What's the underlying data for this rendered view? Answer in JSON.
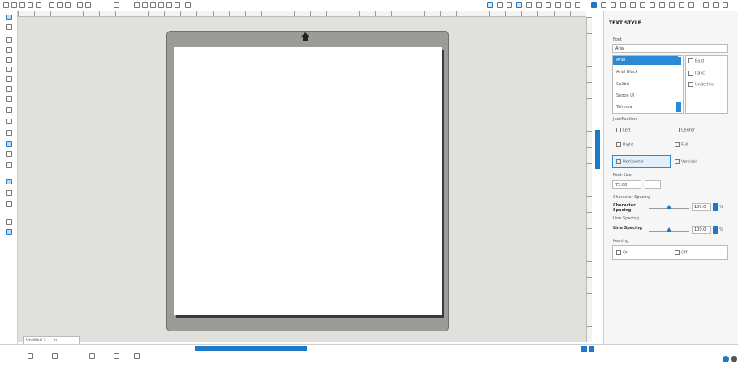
{
  "panel": {
    "title": "TEXT STYLE",
    "font_section_label": "Font",
    "font_search_value": "Arial",
    "font_list": [
      "Arial",
      "Arial Black",
      "Calibri",
      "Segoe UI",
      "Tahoma"
    ],
    "style_options": [
      {
        "label": "Bold",
        "icon": "bold-icon"
      },
      {
        "label": "Italic",
        "icon": "italic-icon"
      },
      {
        "label": "Underline",
        "icon": "underline-icon"
      }
    ],
    "justification_label": "Justification",
    "justification_options": [
      {
        "label": "Left",
        "icon": "align-left-icon"
      },
      {
        "label": "Center",
        "icon": "align-center-icon"
      },
      {
        "label": "Right",
        "icon": "align-right-icon"
      },
      {
        "label": "Full",
        "icon": "align-full-icon"
      }
    ],
    "direction_options": [
      {
        "label": "Horizontal",
        "icon": "text-horizontal-icon"
      },
      {
        "label": "Vertical",
        "icon": "text-vertical-icon"
      }
    ],
    "font_size_label": "Font Size",
    "font_size_value": "72.00",
    "char_spacing_section": "Character Spacing",
    "char_spacing_label": "Character Spacing",
    "char_spacing_value": "100.0",
    "line_spacing_section": "Line Spacing",
    "line_spacing_label": "Line Spacing",
    "line_spacing_value": "100.0",
    "percent_unit": "%",
    "kerning_label": "Kerning",
    "kerning_options": [
      {
        "label": "On",
        "icon": "kerning-on-icon"
      },
      {
        "label": "Off",
        "icon": "kerning-off-icon"
      }
    ]
  },
  "document_tab": {
    "label": "Untitled-1",
    "close": "×"
  },
  "colors": {
    "accent": "#1e78c8",
    "mat": "#9b9b98",
    "canvas": "#e0e0dd"
  }
}
